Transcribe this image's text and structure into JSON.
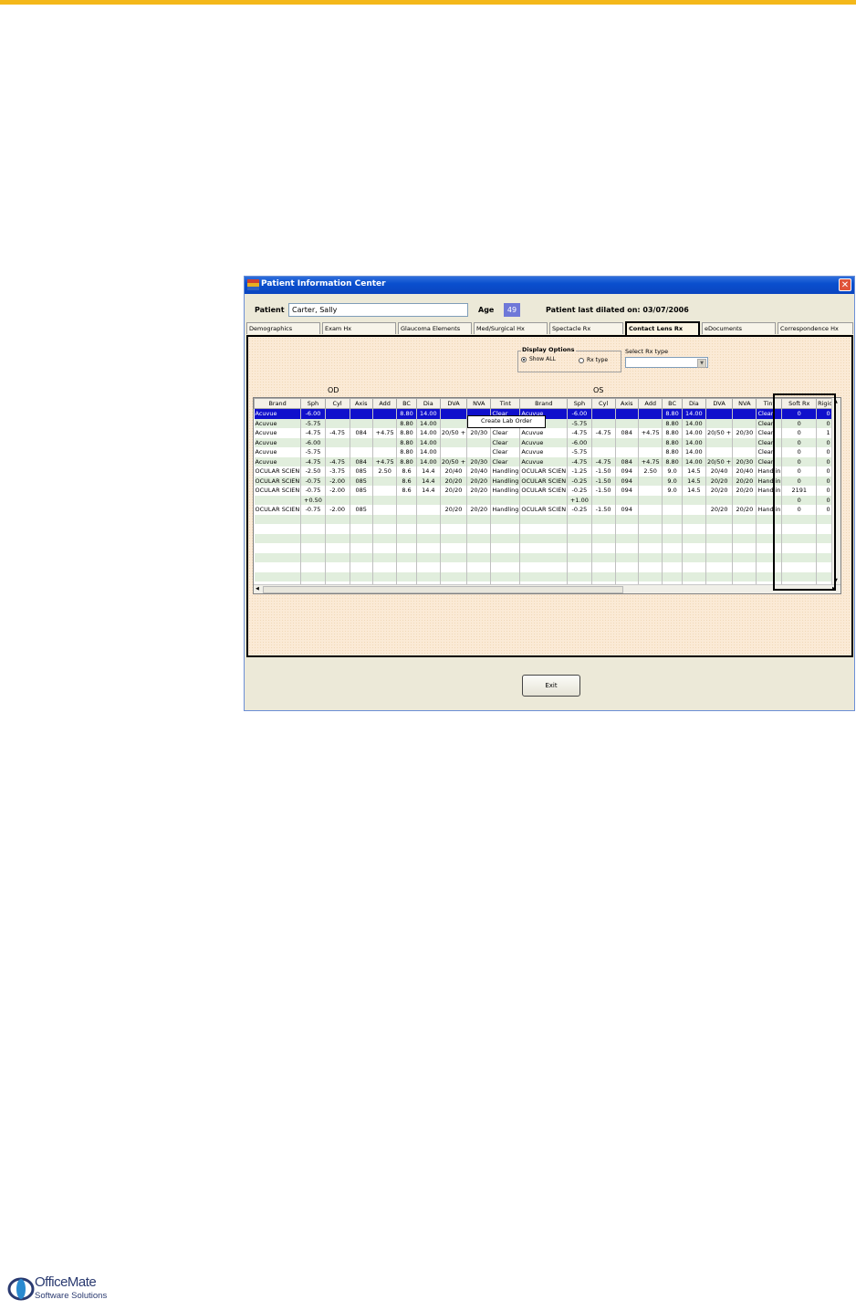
{
  "window": {
    "title": "Patient Information Center",
    "close_label": "✕"
  },
  "patient": {
    "label": "Patient",
    "name": "Carter, Sally",
    "age_label": "Age",
    "age": "49",
    "dilated_text": "Patient last dilated on: 03/07/2006"
  },
  "tabs": [
    {
      "label": "Demographics",
      "active": false
    },
    {
      "label": "Exam Hx",
      "active": false
    },
    {
      "label": "Glaucoma Elements",
      "active": false
    },
    {
      "label": "Med/Surgical Hx",
      "active": false
    },
    {
      "label": "Spectacle Rx",
      "active": false
    },
    {
      "label": "Contact Lens Rx",
      "active": true
    },
    {
      "label": "eDocuments",
      "active": false
    },
    {
      "label": "Correspondence Hx",
      "active": false
    }
  ],
  "display_options": {
    "legend": "Display Options",
    "show_all": "Show ALL",
    "rx_type": "Rx type",
    "selected": "Show ALL"
  },
  "select_rx": {
    "label": "Select Rx type",
    "value": ""
  },
  "groups": {
    "od": "OD",
    "os": "OS"
  },
  "columns": [
    "Brand",
    "Sph",
    "Cyl",
    "Axis",
    "Add",
    "BC",
    "Dia",
    "DVA",
    "NVA",
    "Tint",
    "Brand",
    "Sph",
    "Cyl",
    "Axis",
    "Add",
    "BC",
    "Dia",
    "DVA",
    "NVA",
    "Tint",
    "Soft Rx",
    "Rigid R"
  ],
  "rows": [
    [
      "Acuvue",
      "-6.00",
      "",
      "",
      "",
      "8.80",
      "14.00",
      "",
      "",
      "Clear",
      "Acuvue",
      "-6.00",
      "",
      "",
      "",
      "8.80",
      "14.00",
      "",
      "",
      "Clear",
      "0",
      "0"
    ],
    [
      "Acuvue",
      "-5.75",
      "",
      "",
      "",
      "8.80",
      "14.00",
      "",
      "",
      "",
      "",
      "-5.75",
      "",
      "",
      "",
      "8.80",
      "14.00",
      "",
      "",
      "Clear",
      "0",
      "0"
    ],
    [
      "Acuvue",
      "-4.75",
      "-4.75",
      "084",
      "+4.75",
      "8.80",
      "14.00",
      "20/50 +",
      "20/30",
      "Clear",
      "Acuvue",
      "-4.75",
      "-4.75",
      "084",
      "+4.75",
      "8.80",
      "14.00",
      "20/50 +",
      "20/30",
      "Clear",
      "0",
      "1"
    ],
    [
      "Acuvue",
      "-6.00",
      "",
      "",
      "",
      "8.80",
      "14.00",
      "",
      "",
      "Clear",
      "Acuvue",
      "-6.00",
      "",
      "",
      "",
      "8.80",
      "14.00",
      "",
      "",
      "Clear",
      "0",
      "0"
    ],
    [
      "Acuvue",
      "-5.75",
      "",
      "",
      "",
      "8.80",
      "14.00",
      "",
      "",
      "Clear",
      "Acuvue",
      "-5.75",
      "",
      "",
      "",
      "8.80",
      "14.00",
      "",
      "",
      "Clear",
      "0",
      "0"
    ],
    [
      "Acuvue",
      "-4.75",
      "-4.75",
      "084",
      "+4.75",
      "8.80",
      "14.00",
      "20/50 +",
      "20/30",
      "Clear",
      "Acuvue",
      "-4.75",
      "-4.75",
      "084",
      "+4.75",
      "8.80",
      "14.00",
      "20/50 +",
      "20/30",
      "Clear",
      "0",
      "0"
    ],
    [
      "OCULAR SCIEN",
      "-2.50",
      "-3.75",
      "085",
      "2.50",
      "8.6",
      "14.4",
      "20/40",
      "20/40",
      "Handling",
      "OCULAR SCIEN",
      "-1.25",
      "-1.50",
      "094",
      "2.50",
      "9.0",
      "14.5",
      "20/40",
      "20/40",
      "Handlin",
      "0",
      "0"
    ],
    [
      "OCULAR SCIEN",
      "-0.75",
      "-2.00",
      "085",
      "",
      "8.6",
      "14.4",
      "20/20",
      "20/20",
      "Handling",
      "OCULAR SCIEN",
      "-0.25",
      "-1.50",
      "094",
      "",
      "9.0",
      "14.5",
      "20/20",
      "20/20",
      "Handlin",
      "0",
      "0"
    ],
    [
      "OCULAR SCIEN",
      "-0.75",
      "-2.00",
      "085",
      "",
      "8.6",
      "14.4",
      "20/20",
      "20/20",
      "Handling",
      "OCULAR SCIEN",
      "-0.25",
      "-1.50",
      "094",
      "",
      "9.0",
      "14.5",
      "20/20",
      "20/20",
      "Handlin",
      "2191",
      "0"
    ],
    [
      "",
      "+0.50",
      "",
      "",
      "",
      "",
      "",
      "",
      "",
      "",
      "",
      "+1.00",
      "",
      "",
      "",
      "",
      "",
      "",
      "",
      "",
      "0",
      "0"
    ],
    [
      "OCULAR SCIEN",
      "-0.75",
      "-2.00",
      "085",
      "",
      "",
      "",
      "20/20",
      "20/20",
      "Handling",
      "OCULAR SCIEN",
      "-0.25",
      "-1.50",
      "094",
      "",
      "",
      "",
      "20/20",
      "20/20",
      "Handlin",
      "0",
      "0"
    ]
  ],
  "selected_row": 0,
  "empty_rows": 8,
  "context_menu": {
    "item": "Create Lab Order"
  },
  "exit_button": "Exit",
  "logo": {
    "line1": "OfficeMate",
    "line2": "Software Solutions"
  },
  "colors": {
    "accent_bar": "#f4b81a",
    "selection": "#1010cc",
    "alt_row": "#e1eedd"
  }
}
